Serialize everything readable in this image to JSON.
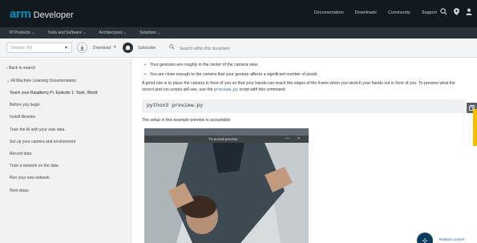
{
  "header": {
    "brand_arm": "arm",
    "brand_product": "Developer",
    "nav": [
      "Documentation",
      "Downloads",
      "Community",
      "Support"
    ],
    "icons": [
      "search-icon",
      "location-pin-icon",
      "user-icon"
    ]
  },
  "subnav": {
    "items": [
      "IP Products ⌄",
      "Tools and Software ⌄",
      "Architectures ⌄",
      "Solutions ⌄"
    ]
  },
  "toolbar": {
    "version_value": "Version: XX",
    "download_label": "Download",
    "subscribe_label": "Subscribe",
    "search_placeholder": "Search within this document"
  },
  "sidebar": {
    "back_label": "Back to search",
    "section_label": "All Machine Learning Documentation",
    "items": [
      "Teach your Raspberry Pi, Episode 1: Yeah, World",
      "Before you begin",
      "Install libraries",
      "Train the AI with your own data",
      "Set up your camera and environment",
      "Record data",
      "Train a network on the data",
      "Run your new network",
      "Next steps"
    ]
  },
  "content": {
    "bullet1": "Your gestures are roughly in the center of the camera view.",
    "bullet2": "You are close enough to the camera that your gesture affects a significant number of pixels.",
    "para1_a": "A good rule is to place the camera in front of you so that your hands can reach the edges of the frame when you stretch your hands out in front of you. To preview what the record and run scripts will see, use the",
    "para1_code": "preview.py",
    "para1_b": "script with this command:",
    "command": "python3 preview.py",
    "para2": "The setup in this example preview is acceptable:"
  },
  "preview": {
    "title": "TV-ai-test-preview",
    "minimize": "—",
    "close": "×"
  },
  "assistant": {
    "label": "Related content"
  },
  "colors": {
    "brand_blue": "#0091bd",
    "topbar_bg": "#12191f",
    "subnav_bg": "#283238",
    "sidebar_bg": "#f2f2f2",
    "accent_yellow": "#f0c000"
  }
}
